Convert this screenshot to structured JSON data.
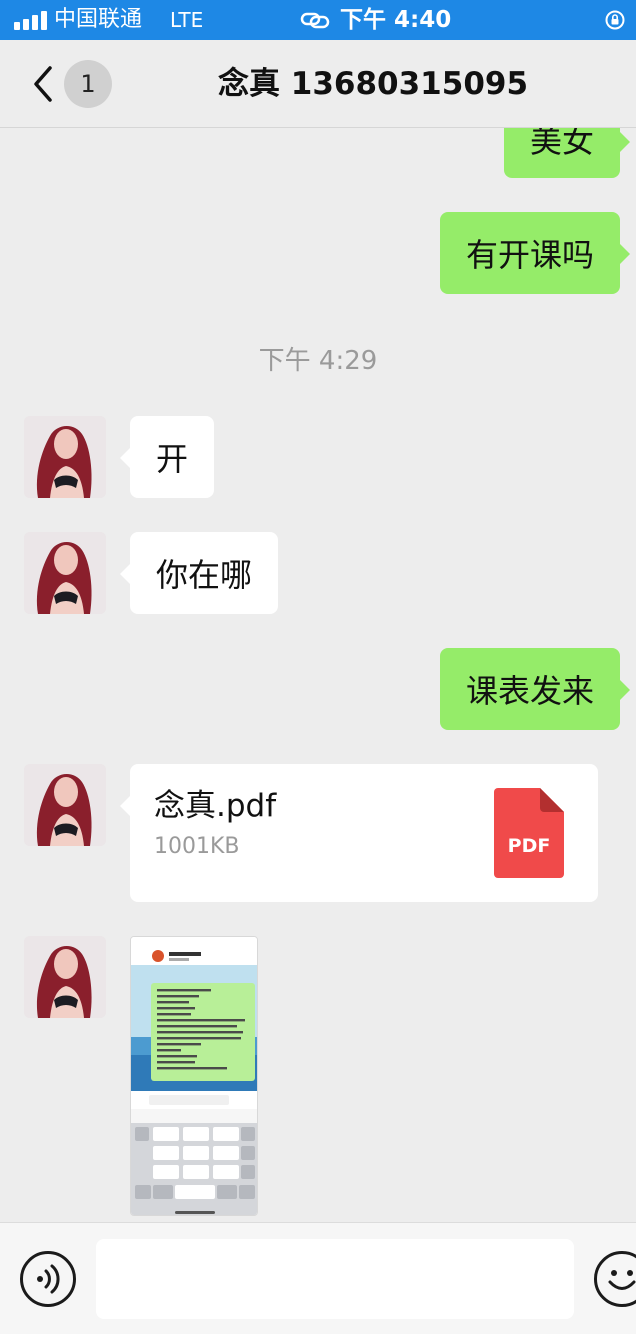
{
  "status_bar": {
    "carrier": "中国联通",
    "network": "LTE",
    "time": "下午 4:40",
    "icons": [
      "signal-icon",
      "hotspot-link-icon",
      "rotation-lock-icon"
    ]
  },
  "nav": {
    "unread_count": "1",
    "title": "念真 13680315095",
    "icons": [
      "back-chevron-icon"
    ]
  },
  "messages": {
    "partial_out": "美女",
    "out_1": "有开课吗",
    "timestamp": "下午 4:29",
    "in_1": "开",
    "in_2": "你在哪",
    "out_2": "课表发来",
    "file": {
      "name": "念真.pdf",
      "size": "1001KB",
      "icon_label": "PDF",
      "icon_color": "#f04a4a"
    }
  },
  "colors": {
    "status_bar": "#1e88e5",
    "outgoing_bubble": "#95ec69",
    "incoming_bubble": "#ffffff",
    "background": "#ededed"
  },
  "input_bar": {
    "icons": [
      "voice-icon",
      "emoji-icon"
    ]
  }
}
